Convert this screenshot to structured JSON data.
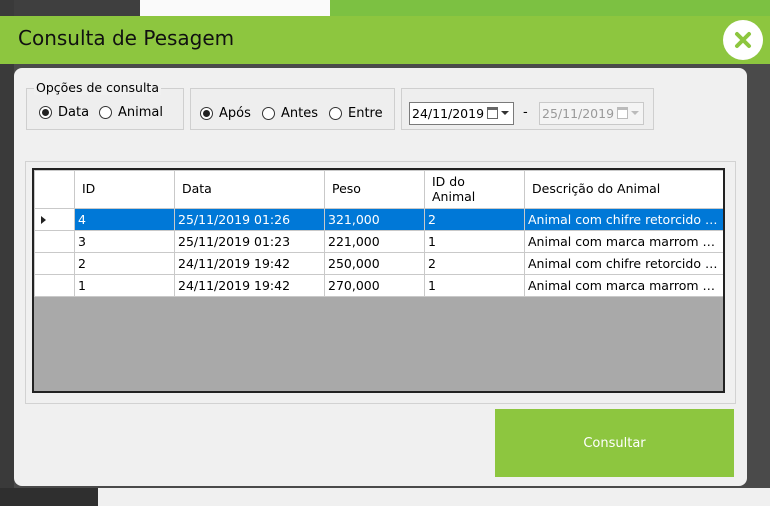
{
  "window": {
    "title": "Consulta de Pesagem",
    "close_icon": "close-icon",
    "accent_color": "#8dc63f"
  },
  "query_options": {
    "legend": "Opções  de consulta",
    "by_date_label": "Data",
    "by_animal_label": "Animal",
    "selected": "Data"
  },
  "filter": {
    "after_label": "Após",
    "before_label": "Antes",
    "between_label": "Entre",
    "selected": "Após"
  },
  "dates": {
    "start": "24/11/2019",
    "separator": "-",
    "end": "25/11/2019"
  },
  "table": {
    "columns": [
      "ID",
      "Data",
      "Peso",
      "ID do\nAnimal",
      "Descrição do Animal"
    ],
    "rows": [
      {
        "id": "4",
        "data": "25/11/2019 01:26",
        "peso": "321,000",
        "id_animal": "2",
        "descricao": "Animal com chifre retorcido pa..."
      },
      {
        "id": "3",
        "data": "25/11/2019 01:23",
        "peso": "221,000",
        "id_animal": "1",
        "descricao": "Animal com marca marrom no ..."
      },
      {
        "id": "2",
        "data": "24/11/2019 19:42",
        "peso": "250,000",
        "id_animal": "2",
        "descricao": "Animal com chifre retorcido pa..."
      },
      {
        "id": "1",
        "data": "24/11/2019 19:42",
        "peso": "270,000",
        "id_animal": "1",
        "descricao": "Animal com marca marrom no ..."
      }
    ],
    "selected_row": 0
  },
  "actions": {
    "consultar_label": "Consultar"
  }
}
